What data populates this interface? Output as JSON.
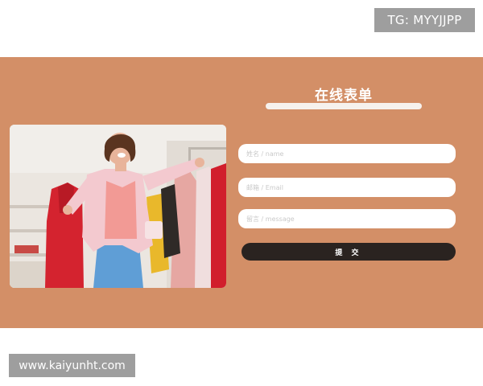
{
  "watermark": {
    "tg": "TG: MYYJJPP",
    "url": "www.kaiyunht.com"
  },
  "form": {
    "title": "在线表单",
    "name_placeholder": "姓名 / name",
    "email_placeholder": "邮箱 / Email",
    "message_placeholder": "留言 / message",
    "submit_label": "提 交"
  },
  "colors": {
    "background": "#d38f67",
    "button": "#2a2320",
    "field": "#ffffff",
    "badge": "#9e9e9e"
  },
  "image": {
    "subject": "woman-shopping-clothes-photo"
  }
}
